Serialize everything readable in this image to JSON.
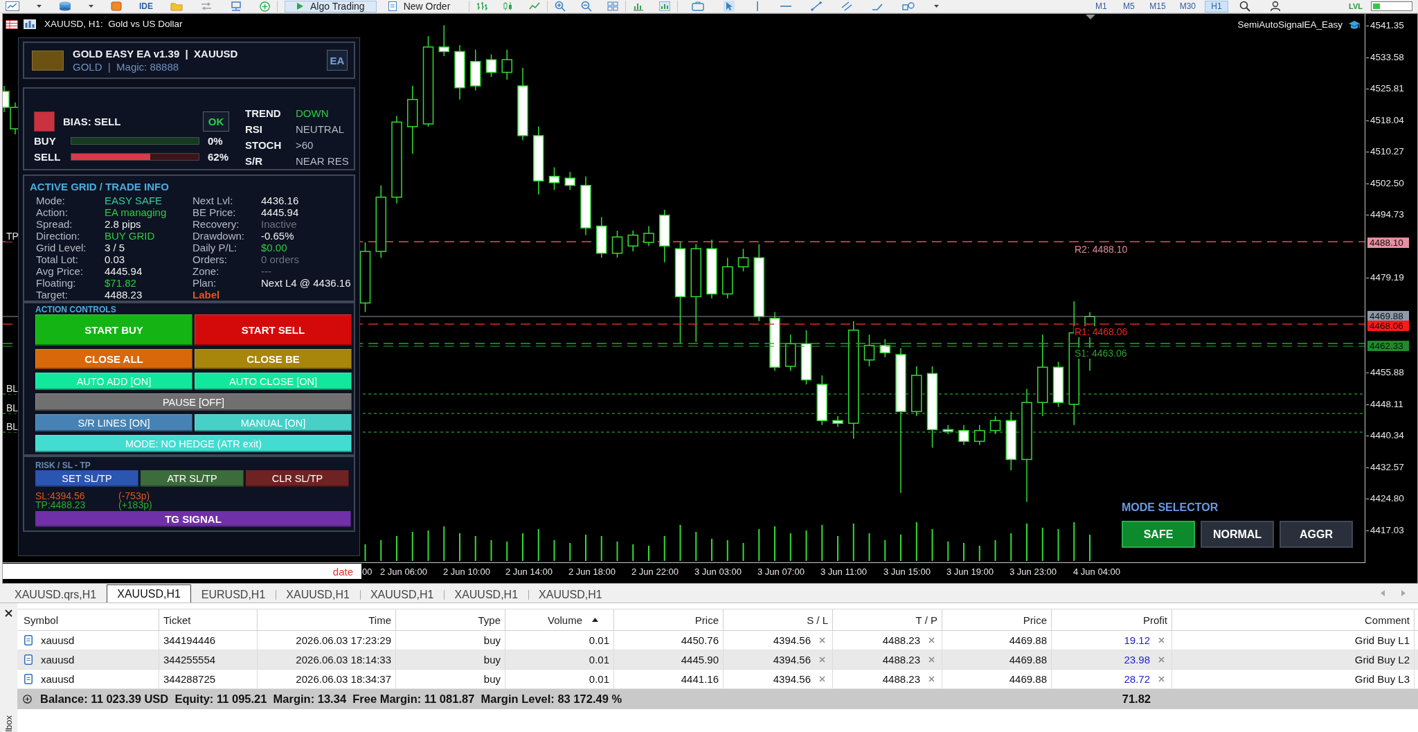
{
  "toolbar": {
    "ide_label": "IDE",
    "buttons": [
      {
        "kind": "algo",
        "label": "Algo Trading",
        "selected": true
      },
      {
        "kind": "order",
        "label": "New Order",
        "selected": false
      }
    ],
    "timeframes": [
      {
        "label": "M1",
        "selected": false
      },
      {
        "label": "M5",
        "selected": false
      },
      {
        "label": "M15",
        "selected": false
      },
      {
        "label": "M30",
        "selected": false
      },
      {
        "label": "H1",
        "selected": true
      }
    ],
    "level_label": "LVL"
  },
  "chart": {
    "title": "XAUUSD, H1:  Gold vs US Dollar",
    "expert_name": "SemiAutoSignalEA_Easy",
    "line_labels": [
      {
        "text": "TP",
        "color": "#e6e6e6"
      },
      {
        "text": "R2: 4488.10",
        "color": "#e2899b"
      },
      {
        "text": "R1: 4468.06",
        "color": "#e8271f"
      },
      {
        "text": "S1: 4463.06",
        "color": "#2f9e35"
      },
      {
        "text": "BL",
        "color": "#e6e6e6"
      },
      {
        "text": "BL",
        "color": "#e6e6e6"
      },
      {
        "text": "BL",
        "color": "#e6e6e6"
      }
    ],
    "price_axis": {
      "ticks": [
        "4541.35",
        "4533.58",
        "4525.81",
        "4518.04",
        "4510.27",
        "4502.50",
        "4494.73",
        "4479.19",
        "4455.88",
        "4448.11",
        "4440.34",
        "4432.57",
        "4424.80",
        "4417.03"
      ],
      "tags": [
        {
          "text": "4488.10",
          "color": "#e88fa0"
        },
        {
          "text": "4469.88",
          "color": "#8d9aaa"
        },
        {
          "text": "4468.06",
          "color": "#ff1a1a"
        },
        {
          "text": "4462.33",
          "color": "#1e8c2a"
        }
      ]
    },
    "time_axis": {
      "labels": [
        "00",
        "2 Jun 06:00",
        "2 Jun 10:00",
        "2 Jun 14:00",
        "2 Jun 18:00",
        "2 Jun 22:00",
        "3 Jun 03:00",
        "3 Jun 07:00",
        "3 Jun 11:00",
        "3 Jun 15:00",
        "3 Jun 19:00",
        "3 Jun 23:00",
        "4 Jun 04:00"
      ]
    },
    "date_field": {
      "placeholder": "date"
    },
    "ea_panel": {
      "header": {
        "title": "GOLD EASY EA v1.39  |  XAUUSD",
        "subtitle": "GOLD  |  Magic: 88888",
        "badge": "EA"
      },
      "bias": {
        "label": "BIAS: SELL",
        "status": "OK",
        "meters": [
          {
            "kind": "buy",
            "label": "BUY",
            "level": 0,
            "reading": "0%"
          },
          {
            "kind": "sell",
            "label": "SELL",
            "level": 0.62,
            "reading": "62%"
          }
        ],
        "indicators": [
          {
            "name": "TREND",
            "value": "DOWN",
            "color": "#2ecc40"
          },
          {
            "name": "RSI",
            "value": "NEUTRAL",
            "color": "#b4bcc6"
          },
          {
            "name": "STOCH",
            "value": ">60",
            "color": "#b4bcc6"
          },
          {
            "name": "S/R",
            "value": "NEAR RES",
            "color": "#b4bcc6"
          }
        ]
      },
      "trade_info": {
        "title": "ACTIVE GRID / TRADE INFO",
        "fields": [
          {
            "kind": "field",
            "label": "Mode:",
            "value": "EASY SAFE",
            "color": "#3cc8a0"
          },
          {
            "kind": "field",
            "label": "Next Lvl:",
            "value": "4436.16",
            "color": "#f0f0f0"
          },
          {
            "kind": "field",
            "label": "Action:",
            "value": "EA managing",
            "color": "#2ecc40"
          },
          {
            "kind": "field",
            "label": "BE Price:",
            "value": "4445.94",
            "color": "#f0f0f0"
          },
          {
            "kind": "field",
            "label": "Spread:",
            "value": "2.8 pips",
            "color": "#f0f0f0"
          },
          {
            "kind": "field",
            "label": "Recovery:",
            "value": "Inactive",
            "color": "#6a7380"
          },
          {
            "kind": "field",
            "label": "Direction:",
            "value": "BUY GRID",
            "color": "#2ecc40"
          },
          {
            "kind": "field",
            "label": "Drawdown:",
            "value": "-0.65%",
            "color": "#f0f0f0"
          },
          {
            "kind": "field",
            "label": "Grid Level:",
            "value": "3 / 5",
            "color": "#f0f0f0"
          },
          {
            "kind": "field",
            "label": "Daily P/L:",
            "value": "$0.00",
            "color": "#2ecc40"
          },
          {
            "kind": "field",
            "label": "Total Lot:",
            "value": "0.03",
            "color": "#f0f0f0"
          },
          {
            "kind": "field",
            "label": "Orders:",
            "value": "0 orders",
            "color": "#6a7380"
          },
          {
            "kind": "field",
            "label": "Avg Price:",
            "value": "4445.94",
            "color": "#f0f0f0"
          },
          {
            "kind": "field",
            "label": "Zone:",
            "value": "---",
            "color": "#6a7380"
          },
          {
            "kind": "field",
            "label": "Floating:",
            "value": "$71.82",
            "color": "#2ecc40"
          },
          {
            "kind": "field",
            "label": "Plan:",
            "value": "Next L4 @ 4436.16",
            "color": "#f0f0f0"
          },
          {
            "kind": "field",
            "label": "Target:",
            "value": "4488.23",
            "color": "#f0f0f0"
          },
          {
            "kind": "note",
            "label": "Label",
            "color": "#e8501e"
          }
        ]
      },
      "action_controls": {
        "title": "ACTION CONTROLS",
        "buttons": [
          {
            "kind": "primary",
            "label": "START BUY",
            "color": "#14b414"
          },
          {
            "kind": "primary",
            "label": "START SELL",
            "color": "#d40a0a"
          },
          {
            "kind": "action",
            "label": "CLOSE ALL",
            "color": "#d8680a"
          },
          {
            "kind": "action",
            "label": "CLOSE BE",
            "color": "#a8860c"
          },
          {
            "kind": "toggle",
            "label": "AUTO ADD [ON]",
            "color": "#12e89c"
          },
          {
            "kind": "toggle",
            "label": "AUTO CLOSE [ON]",
            "color": "#12e89c"
          },
          {
            "kind": "wide",
            "label": "PAUSE [OFF]",
            "color": "#707070"
          },
          {
            "kind": "toggle",
            "label": "S/R LINES [ON]",
            "color": "#4682b4"
          },
          {
            "kind": "toggle",
            "label": "MANUAL [ON]",
            "color": "#46d0c8"
          },
          {
            "kind": "wide",
            "label": "MODE: NO HEDGE (ATR exit)",
            "color": "#42dcd0"
          }
        ]
      },
      "risk": {
        "title": "RISK / SL - TP",
        "buttons": [
          {
            "label": "SET SL/TP",
            "color": "#2a55b0"
          },
          {
            "label": "ATR SL/TP",
            "color": "#3c6b3c"
          },
          {
            "label": "CLR SL/TP",
            "color": "#6e2222"
          }
        ],
        "levels": [
          {
            "label": "SL:4394.56",
            "note": "(-753p)",
            "color": "#e0561e"
          },
          {
            "label": "TP:4488.23",
            "note": "(+183p)",
            "color": "#2eaa2e"
          }
        ],
        "signal_button": "TG SIGNAL"
      }
    },
    "mode_selector": {
      "title": "MODE SELECTOR",
      "buttons": [
        {
          "label": "SAFE",
          "selected": true
        },
        {
          "label": "NORMAL",
          "selected": false
        },
        {
          "label": "AGGR",
          "selected": false
        }
      ]
    }
  },
  "chart_tabs": [
    {
      "label": "XAUUSD.qrs,H1",
      "selected": false
    },
    {
      "label": "XAUUSD,H1",
      "selected": true
    },
    {
      "label": "EURUSD,H1",
      "selected": false
    },
    {
      "label": "XAUUSD,H1",
      "selected": false
    },
    {
      "label": "XAUUSD,H1",
      "selected": false
    },
    {
      "label": "XAUUSD,H1",
      "selected": false
    },
    {
      "label": "XAUUSD,H1",
      "selected": false
    }
  ],
  "toolbox": {
    "label": "lbox",
    "columns": [
      {
        "label": "Symbol",
        "sorted": false
      },
      {
        "label": "Ticket",
        "sorted": false
      },
      {
        "label": "Time",
        "sorted": false
      },
      {
        "label": "Type",
        "sorted": false
      },
      {
        "label": "Volume",
        "sorted": true
      },
      {
        "label": "Price",
        "sorted": false
      },
      {
        "label": "S / L",
        "sorted": false
      },
      {
        "label": "T / P",
        "sorted": false
      },
      {
        "label": "Price",
        "sorted": false
      },
      {
        "label": "Profit",
        "sorted": false
      },
      {
        "label": "Comment",
        "sorted": false
      }
    ],
    "rows": [
      {
        "selected": false,
        "cells": [
          "xauusd",
          "344194446",
          "2026.06.03 17:23:29",
          "buy",
          "0.01",
          "4450.76",
          "4394.56",
          "4488.23",
          "4469.88",
          "19.12",
          "Grid Buy L1"
        ]
      },
      {
        "selected": true,
        "cells": [
          "xauusd",
          "344255554",
          "2026.06.03 18:14:33",
          "buy",
          "0.01",
          "4445.90",
          "4394.56",
          "4488.23",
          "4469.88",
          "23.98",
          "Grid Buy L2"
        ]
      },
      {
        "selected": false,
        "cells": [
          "xauusd",
          "344288725",
          "2026.06.03 18:34:37",
          "buy",
          "0.01",
          "4441.16",
          "4394.56",
          "4488.23",
          "4469.88",
          "28.72",
          "Grid Buy L3"
        ]
      }
    ],
    "summary": {
      "text": "Balance: 11 023.39 USD  Equity: 11 095.21  Margin: 13.34  Free Margin: 11 081.87  Margin Level: 83 172.49 %",
      "profit": "71.82"
    }
  }
}
